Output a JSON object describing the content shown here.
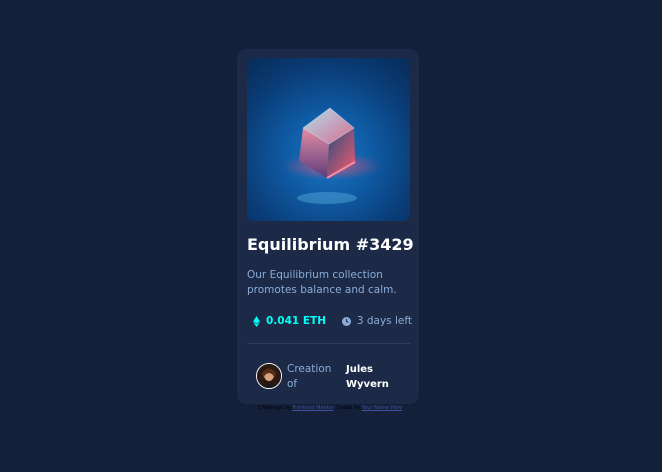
{
  "card": {
    "title": "Equilibrium #3429",
    "description": "Our Equilibrium collection promotes balance and calm.",
    "price": "0.041 ETH",
    "time_left": "3 days left",
    "creator_prefix": "Creation of",
    "creator_name": "Jules Wyvern"
  },
  "attribution": {
    "text_1": "Challenge by",
    "link_1": "Frontend Mentor",
    "text_2": ". Coded by",
    "link_2": "Your Name Here",
    "text_3": "."
  },
  "colors": {
    "page_bg": "#14203a",
    "card_bg": "#1c2a47",
    "price": "#00fff8",
    "muted": "#8bacd9",
    "white": "#ffffff",
    "link": "#3e52a3"
  },
  "icons": {
    "price": "ethereum-icon",
    "time": "clock-icon"
  }
}
